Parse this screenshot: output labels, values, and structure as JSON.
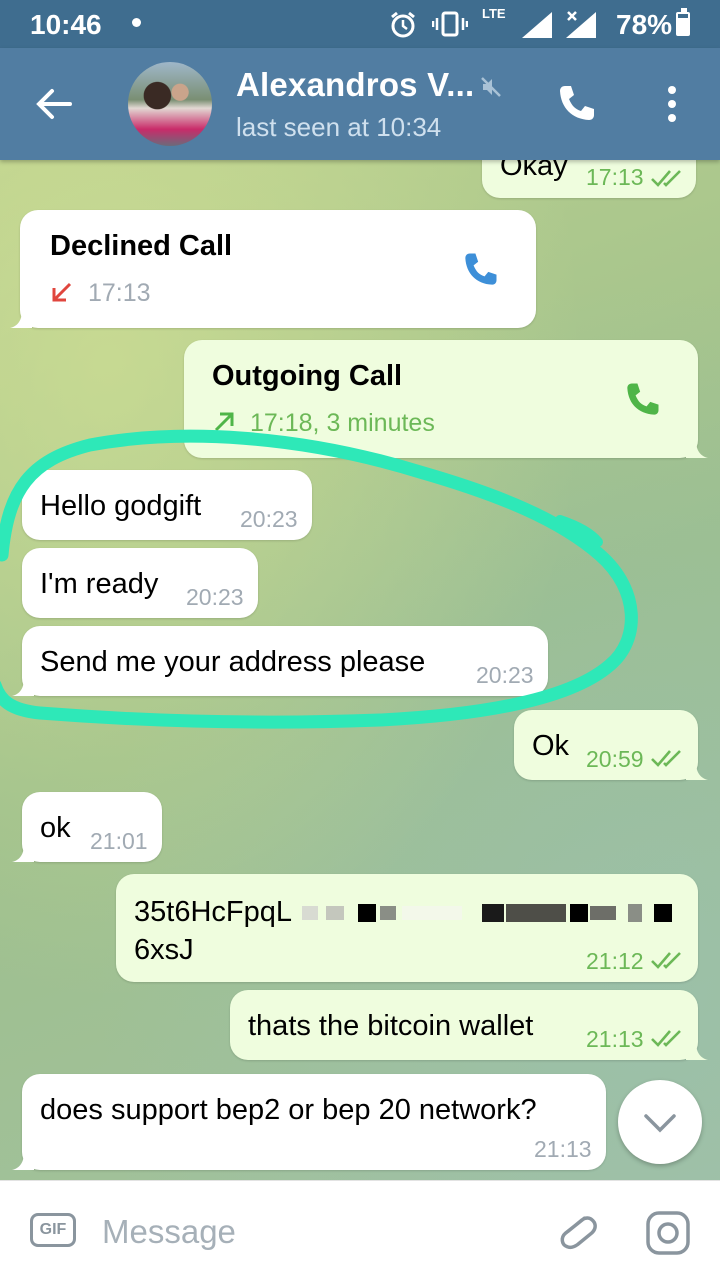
{
  "status": {
    "time": "10:46",
    "battery": "78%",
    "network": "LTE"
  },
  "header": {
    "contact_name": "Alexandros V...",
    "last_seen": "last seen at 10:34"
  },
  "messages": [
    {
      "type": "outgoing",
      "text": "Okay",
      "time": "17:13"
    },
    {
      "type": "call",
      "direction": "incoming",
      "title": "Declined Call",
      "detail": "17:13"
    },
    {
      "type": "call",
      "direction": "outgoing",
      "title": "Outgoing Call",
      "detail": "17:18, 3 minutes"
    },
    {
      "type": "incoming",
      "text": "Hello godgift",
      "time": "20:23"
    },
    {
      "type": "incoming",
      "text": "I'm ready",
      "time": "20:23"
    },
    {
      "type": "incoming",
      "text": "Send me your address please",
      "time": "20:23"
    },
    {
      "type": "outgoing",
      "text": "Ok",
      "time": "20:59"
    },
    {
      "type": "incoming",
      "text": "ok",
      "time": "21:01"
    },
    {
      "type": "outgoing",
      "text_line1": "35t6HcFpqL",
      "text_line2": "6xsJ",
      "time": "21:12"
    },
    {
      "type": "outgoing",
      "text": "thats the bitcoin wallet",
      "time": "21:13"
    },
    {
      "type": "incoming",
      "text": "does support bep2 or bep 20 network?",
      "time": "21:13"
    }
  ],
  "input": {
    "gif_label": "GIF",
    "placeholder": "Message"
  },
  "colors": {
    "header": "#517da2",
    "statusbar": "#3f6d8f",
    "outgoing_bubble": "#effdde",
    "incoming_bubble": "#ffffff",
    "highlight_scribble": "#2ee8b8"
  }
}
